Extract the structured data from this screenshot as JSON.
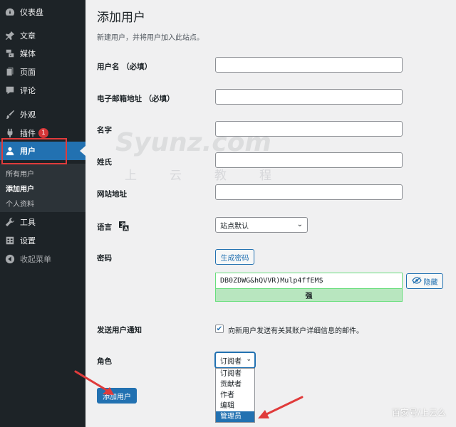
{
  "sidebar": {
    "items": [
      {
        "label": "仪表盘",
        "icon": "dashboard-icon"
      },
      {
        "label": "文章",
        "icon": "pin-icon"
      },
      {
        "label": "媒体",
        "icon": "media-icon"
      },
      {
        "label": "页面",
        "icon": "page-icon"
      },
      {
        "label": "评论",
        "icon": "comment-icon"
      },
      {
        "label": "外观",
        "icon": "brush-icon"
      },
      {
        "label": "插件",
        "icon": "plugin-icon",
        "badge": "1"
      },
      {
        "label": "用户",
        "icon": "user-icon"
      },
      {
        "label": "工具",
        "icon": "wrench-icon"
      },
      {
        "label": "设置",
        "icon": "settings-icon"
      },
      {
        "label": "收起菜单",
        "icon": "collapse-icon"
      }
    ],
    "submenu": [
      "所有用户",
      "添加用户",
      "个人资料"
    ]
  },
  "page": {
    "title": "添加用户",
    "description": "新建用户，并将用户加入此站点。"
  },
  "form": {
    "username_label": "用户名 （必填）",
    "email_label": "电子邮箱地址 （必填）",
    "firstname_label": "名字",
    "lastname_label": "姓氏",
    "website_label": "网站地址",
    "language_label": "语言",
    "language_value": "站点默认",
    "password_label": "密码",
    "generate_password": "生成密码",
    "password_value": "DB0ZDWG&hQVVR)Mulp4ffEM$",
    "strength": "强",
    "hide_label": "隐藏",
    "notify_label": "发送用户通知",
    "notify_text": "向新用户发送有关其账户详细信息的邮件。",
    "role_label": "角色",
    "role_value": "订阅者",
    "role_options": [
      "订阅者",
      "贡献者",
      "作者",
      "编辑",
      "管理员"
    ],
    "submit": "添加用户"
  },
  "watermark": {
    "main": "Syunz.com",
    "sub": "上云教程",
    "footer": "百家号/上云么"
  },
  "colors": {
    "accent": "#2271b1",
    "sidebar": "#1d2327",
    "highlight_box": "#e03b3b",
    "strength_bg": "#b8e6bf"
  }
}
